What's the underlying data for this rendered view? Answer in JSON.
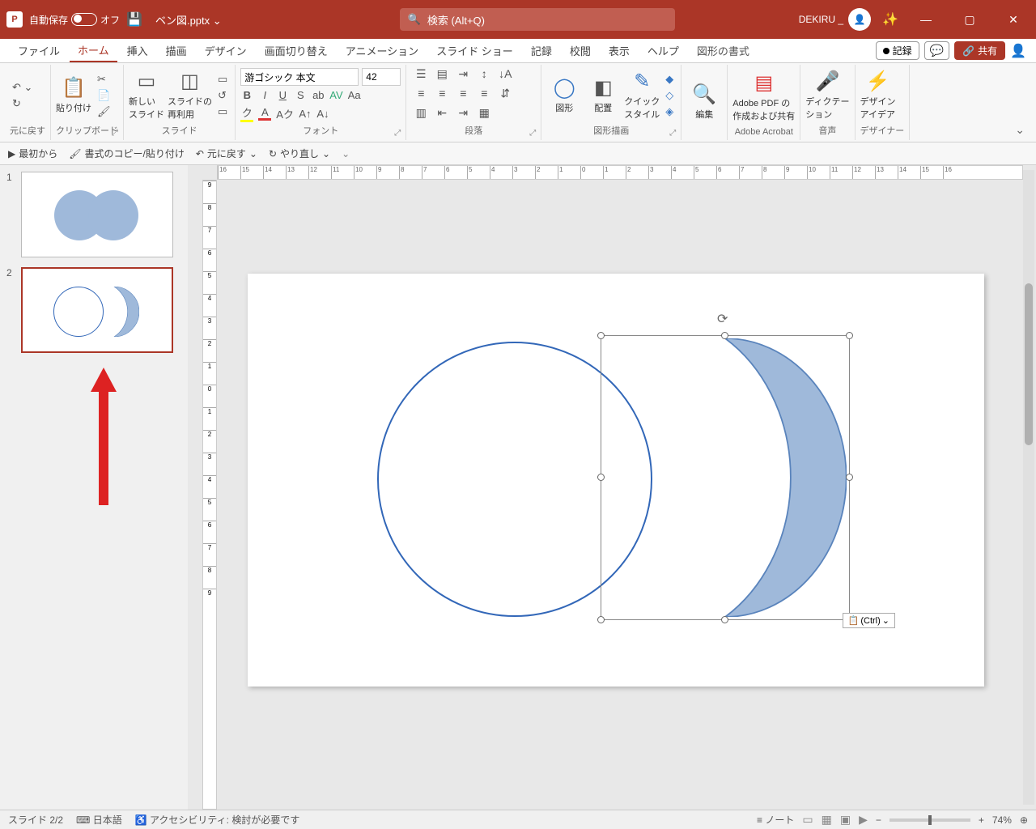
{
  "title": {
    "autosave_label": "自動保存",
    "autosave_state": "オフ",
    "filename": "ベン図.pptx",
    "search_placeholder": "検索 (Alt+Q)",
    "user": "DEKIRU _"
  },
  "tabs": {
    "file": "ファイル",
    "home": "ホーム",
    "insert": "挿入",
    "draw": "描画",
    "design": "デザイン",
    "transition": "画面切り替え",
    "animation": "アニメーション",
    "slideshow": "スライド ショー",
    "record": "記録",
    "review": "校閲",
    "view": "表示",
    "help": "ヘルプ",
    "shapeformat": "図形の書式",
    "record_btn": "記録",
    "share": "共有"
  },
  "ribbon": {
    "undo": "元に戻す",
    "clipboard": "クリップボード",
    "paste": "貼り付け",
    "slides": "スライド",
    "new_slide": "新しい\nスライド",
    "reuse": "スライドの\n再利用",
    "font": "フォント",
    "font_name": "游ゴシック 本文",
    "font_size": "42",
    "paragraph": "段落",
    "drawing": "図形描画",
    "shapes": "図形",
    "arrange": "配置",
    "quick_styles": "クイック\nスタイル",
    "editing": "編集",
    "adobe": "Adobe Acrobat",
    "adobe_btn": "Adobe PDF の\n作成および共有",
    "voice": "音声",
    "dictate": "ディクテー\nション",
    "designer": "デザイナー",
    "design_ideas": "デザイン\nアイデア"
  },
  "qat": {
    "from_start": "最初から",
    "copy_format": "書式のコピー/貼り付け",
    "undo": "元に戻す",
    "redo": "やり直し"
  },
  "thumbs": {
    "n1": "1",
    "n2": "2"
  },
  "canvas": {
    "paste_options": "(Ctrl)"
  },
  "status": {
    "slide": "スライド 2/2",
    "lang": "日本語",
    "a11y": "アクセシビリティ: 検討が必要です",
    "notes": "ノート",
    "zoom": "74%"
  }
}
